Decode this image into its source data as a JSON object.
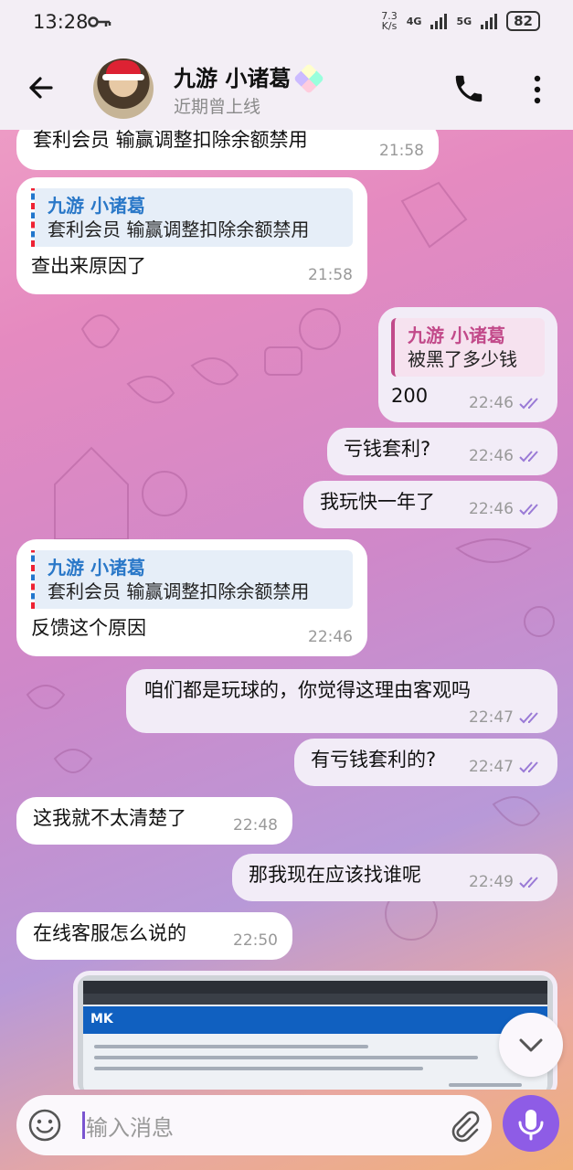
{
  "status": {
    "time": "13:28",
    "net_speed_value": "7.3",
    "net_speed_unit": "K/s",
    "net1": "4G",
    "net2": "5G",
    "battery": "82"
  },
  "header": {
    "name": "九游 小诸葛",
    "presence": "近期曾上线"
  },
  "icons": {
    "back": "arrow-left-icon",
    "call": "phone-icon",
    "menu": "more-vertical-icon",
    "emoji": "emoji-icon",
    "attach": "paperclip-icon",
    "mic": "microphone-icon",
    "scroll": "chevron-down-icon",
    "key": "key-icon",
    "badge": "gem-icon"
  },
  "colors": {
    "accent": "#8e5ce6",
    "quote_in": "#2a78c8",
    "quote_out": "#c24a8a",
    "header_bg": "#f3eef5"
  },
  "messages": [
    {
      "text": "套利会员 输赢调整扣除余额禁用",
      "time": "21:58"
    },
    {
      "quote_name": "九游 小诸葛",
      "quote_text": "套利会员 输赢调整扣除余额禁用",
      "text": "查出来原因了",
      "time": "21:58"
    },
    {
      "quote_name": "九游 小诸葛",
      "quote_text": "被黑了多少钱",
      "text": "200",
      "time": "22:46"
    },
    {
      "text": "亏钱套利?",
      "time": "22:46"
    },
    {
      "text": "我玩快一年了",
      "time": "22:46"
    },
    {
      "quote_name": "九游 小诸葛",
      "quote_text": "套利会员 输赢调整扣除余额禁用",
      "text": "反馈这个原因",
      "time": "22:46"
    },
    {
      "text": "咱们都是玩球的，你觉得这理由客观吗",
      "time": "22:47"
    },
    {
      "text": "有亏钱套利的?",
      "time": "22:47"
    },
    {
      "text": "这我就不太清楚了",
      "time": "22:48"
    },
    {
      "text": "那我现在应该找谁呢",
      "time": "22:49"
    },
    {
      "text": "在线客服怎么说的",
      "time": "22:50"
    }
  ],
  "screenshot": {
    "logo": "MK"
  },
  "composer": {
    "placeholder": "输入消息"
  }
}
